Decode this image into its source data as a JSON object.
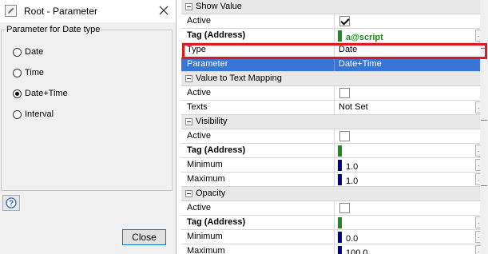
{
  "dialog": {
    "title": "Root - Parameter",
    "group_label": "Parameter for Date type",
    "options": [
      {
        "label": "Date",
        "checked": false
      },
      {
        "label": "Time",
        "checked": false
      },
      {
        "label": "Date+Time",
        "checked": true
      },
      {
        "label": "Interval",
        "checked": false
      }
    ],
    "close_label": "Close",
    "help_icon": "question-mark-icon"
  },
  "grid": {
    "show_value": {
      "header": "Show Value",
      "active_label": "Active",
      "tag_label": "Tag (Address)",
      "tag_value": "a@script",
      "type_label": "Type",
      "type_value": "Date",
      "parameter_label": "Parameter",
      "parameter_value": "Date+Time"
    },
    "mapping": {
      "header": "Value to Text Mapping",
      "active_label": "Active",
      "texts_label": "Texts",
      "texts_value": "Not Set"
    },
    "visibility": {
      "header": "Visibility",
      "active_label": "Active",
      "tag_label": "Tag (Address)",
      "minimum_label": "Minimum",
      "minimum_value": "1.0",
      "maximum_label": "Maximum",
      "maximum_value": "1.0"
    },
    "opacity": {
      "header": "Opacity",
      "active_label": "Active",
      "tag_label": "Tag (Address)",
      "minimum_label": "Minimum",
      "minimum_value": "0.0",
      "maximum_label": "Maximum",
      "maximum_value": "100.0"
    },
    "ellipsis": "..."
  },
  "colors": {
    "selection": "#3875d7",
    "highlight": "#e0191f",
    "script_green": "#1f8a1f",
    "number_bar": "#00008b"
  }
}
